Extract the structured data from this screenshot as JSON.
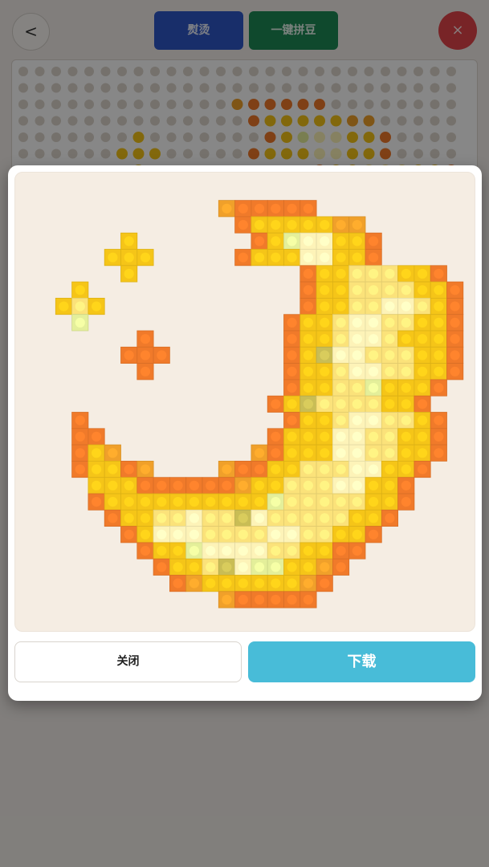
{
  "topbar": {
    "back_label": "<",
    "iron_label": "熨烫",
    "build_label": "一键拼豆",
    "close_label": "×"
  },
  "modal": {
    "close_label": "关闭",
    "download_label": "下载"
  },
  "colors": {
    "background_overlay": "#000000",
    "preview_background": "#f5ede3",
    "download_button": "#48bcd8",
    "iron_button": "#2f58c9",
    "build_button": "#1d8a56",
    "close_button": "#e2454a",
    "bead_orange": "#f07a2a",
    "bead_amber": "#f0a02a",
    "bead_yellow": "#f5c518",
    "bead_lightyellow": "#fbe27a",
    "bead_cream": "#fdf3b8",
    "bead_lime": "#e4ef9a",
    "bead_khaki": "#c9bd55"
  },
  "pattern": {
    "legend": {
      "O": "bead_orange",
      "A": "bead_amber",
      "Y": "bead_yellow",
      "L": "bead_lightyellow",
      "C": "bead_cream",
      "G": "bead_lime",
      "K": "bead_khaki"
    },
    "rows": [
      "...........................",
      "...........................",
      "...........AOOOOO..........",
      "............OYYYYYAA.......",
      ".....Y.......OYGCCYYO......",
      "....YYY.....OYYYCCYYO......",
      ".....Y..........OYYLLLYYO...",
      "..Y.............OYYLLLLYYO..",
      ".YLY............OYYLLCCLYO..",
      "..G............OYYLCCLLYYO..",
      "......O........OYYLCCLYYYO..",
      ".....OOO.......OYKCCLLLYYO.",
      "......O........OYYLCCLLYYO.",
      "...............OYYLLGYYYO..",
      "..............OYKLLLLYYO...",
      "..O............OYYLCCLLYO..",
      "..OO..........OYYYCCLLYYO..",
      "..OYA........AOYYYCCLLYYO..",
      "..OYYOA....AOOYYLLLCCYYO...",
      "...YYYOOOOOOAYYLLLCCYYO....",
      "...OYYYYYYYYYYGLLLLLYYO....",
      "....OYYLLCLLKCLLLLLYYO.....",
      ".....OYCCCLLLLCCLLYYO......",
      "......OYYGCCCCLLYYOO.......",
      ".......OYYLKCGGYYAO........",
      "........OAYYYYYYAO.........",
      "...........AOOOOO.........."
    ]
  }
}
